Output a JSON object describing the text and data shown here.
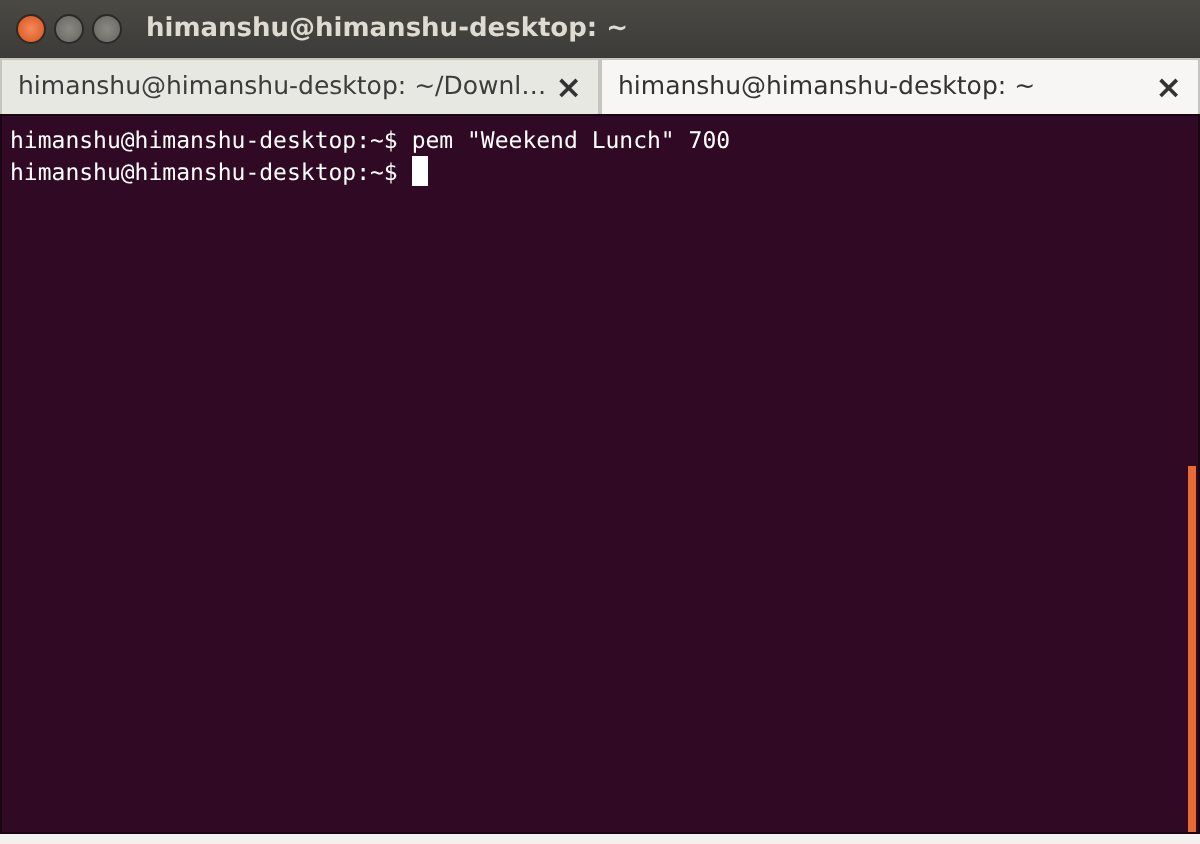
{
  "window": {
    "title": "himanshu@himanshu-desktop: ~"
  },
  "tabs": [
    {
      "label": "himanshu@himanshu-desktop: ~/Downl…",
      "selected": false
    },
    {
      "label": "himanshu@himanshu-desktop: ~",
      "selected": true
    }
  ],
  "close_glyph": "×",
  "terminal": {
    "lines": [
      {
        "prompt": "himanshu@himanshu-desktop:~$",
        "command": "pem \"Weekend Lunch\" 700"
      },
      {
        "prompt": "himanshu@himanshu-desktop:~$"
      }
    ]
  }
}
